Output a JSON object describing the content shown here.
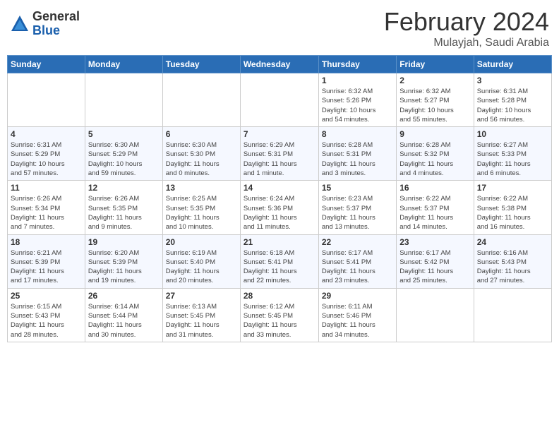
{
  "header": {
    "logo": {
      "general": "General",
      "blue": "Blue"
    },
    "month": "February 2024",
    "location": "Mulayjah, Saudi Arabia"
  },
  "weekdays": [
    "Sunday",
    "Monday",
    "Tuesday",
    "Wednesday",
    "Thursday",
    "Friday",
    "Saturday"
  ],
  "weeks": [
    [
      {
        "day": "",
        "info": ""
      },
      {
        "day": "",
        "info": ""
      },
      {
        "day": "",
        "info": ""
      },
      {
        "day": "",
        "info": ""
      },
      {
        "day": "1",
        "info": "Sunrise: 6:32 AM\nSunset: 5:26 PM\nDaylight: 10 hours\nand 54 minutes."
      },
      {
        "day": "2",
        "info": "Sunrise: 6:32 AM\nSunset: 5:27 PM\nDaylight: 10 hours\nand 55 minutes."
      },
      {
        "day": "3",
        "info": "Sunrise: 6:31 AM\nSunset: 5:28 PM\nDaylight: 10 hours\nand 56 minutes."
      }
    ],
    [
      {
        "day": "4",
        "info": "Sunrise: 6:31 AM\nSunset: 5:29 PM\nDaylight: 10 hours\nand 57 minutes."
      },
      {
        "day": "5",
        "info": "Sunrise: 6:30 AM\nSunset: 5:29 PM\nDaylight: 10 hours\nand 59 minutes."
      },
      {
        "day": "6",
        "info": "Sunrise: 6:30 AM\nSunset: 5:30 PM\nDaylight: 11 hours\nand 0 minutes."
      },
      {
        "day": "7",
        "info": "Sunrise: 6:29 AM\nSunset: 5:31 PM\nDaylight: 11 hours\nand 1 minute."
      },
      {
        "day": "8",
        "info": "Sunrise: 6:28 AM\nSunset: 5:31 PM\nDaylight: 11 hours\nand 3 minutes."
      },
      {
        "day": "9",
        "info": "Sunrise: 6:28 AM\nSunset: 5:32 PM\nDaylight: 11 hours\nand 4 minutes."
      },
      {
        "day": "10",
        "info": "Sunrise: 6:27 AM\nSunset: 5:33 PM\nDaylight: 11 hours\nand 6 minutes."
      }
    ],
    [
      {
        "day": "11",
        "info": "Sunrise: 6:26 AM\nSunset: 5:34 PM\nDaylight: 11 hours\nand 7 minutes."
      },
      {
        "day": "12",
        "info": "Sunrise: 6:26 AM\nSunset: 5:35 PM\nDaylight: 11 hours\nand 9 minutes."
      },
      {
        "day": "13",
        "info": "Sunrise: 6:25 AM\nSunset: 5:35 PM\nDaylight: 11 hours\nand 10 minutes."
      },
      {
        "day": "14",
        "info": "Sunrise: 6:24 AM\nSunset: 5:36 PM\nDaylight: 11 hours\nand 11 minutes."
      },
      {
        "day": "15",
        "info": "Sunrise: 6:23 AM\nSunset: 5:37 PM\nDaylight: 11 hours\nand 13 minutes."
      },
      {
        "day": "16",
        "info": "Sunrise: 6:22 AM\nSunset: 5:37 PM\nDaylight: 11 hours\nand 14 minutes."
      },
      {
        "day": "17",
        "info": "Sunrise: 6:22 AM\nSunset: 5:38 PM\nDaylight: 11 hours\nand 16 minutes."
      }
    ],
    [
      {
        "day": "18",
        "info": "Sunrise: 6:21 AM\nSunset: 5:39 PM\nDaylight: 11 hours\nand 17 minutes."
      },
      {
        "day": "19",
        "info": "Sunrise: 6:20 AM\nSunset: 5:39 PM\nDaylight: 11 hours\nand 19 minutes."
      },
      {
        "day": "20",
        "info": "Sunrise: 6:19 AM\nSunset: 5:40 PM\nDaylight: 11 hours\nand 20 minutes."
      },
      {
        "day": "21",
        "info": "Sunrise: 6:18 AM\nSunset: 5:41 PM\nDaylight: 11 hours\nand 22 minutes."
      },
      {
        "day": "22",
        "info": "Sunrise: 6:17 AM\nSunset: 5:41 PM\nDaylight: 11 hours\nand 23 minutes."
      },
      {
        "day": "23",
        "info": "Sunrise: 6:17 AM\nSunset: 5:42 PM\nDaylight: 11 hours\nand 25 minutes."
      },
      {
        "day": "24",
        "info": "Sunrise: 6:16 AM\nSunset: 5:43 PM\nDaylight: 11 hours\nand 27 minutes."
      }
    ],
    [
      {
        "day": "25",
        "info": "Sunrise: 6:15 AM\nSunset: 5:43 PM\nDaylight: 11 hours\nand 28 minutes."
      },
      {
        "day": "26",
        "info": "Sunrise: 6:14 AM\nSunset: 5:44 PM\nDaylight: 11 hours\nand 30 minutes."
      },
      {
        "day": "27",
        "info": "Sunrise: 6:13 AM\nSunset: 5:45 PM\nDaylight: 11 hours\nand 31 minutes."
      },
      {
        "day": "28",
        "info": "Sunrise: 6:12 AM\nSunset: 5:45 PM\nDaylight: 11 hours\nand 33 minutes."
      },
      {
        "day": "29",
        "info": "Sunrise: 6:11 AM\nSunset: 5:46 PM\nDaylight: 11 hours\nand 34 minutes."
      },
      {
        "day": "",
        "info": ""
      },
      {
        "day": "",
        "info": ""
      }
    ]
  ]
}
